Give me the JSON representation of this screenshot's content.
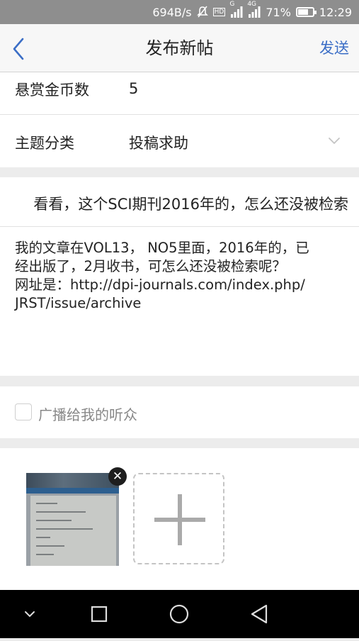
{
  "status_bar": {
    "net_speed": "694B/s",
    "hd_label": "HD",
    "signal_1_tag": "G",
    "signal_2_tag": "4G",
    "battery_percent": "71%",
    "battery_level": 0.71,
    "time": "12:29"
  },
  "nav": {
    "title": "发布新帖",
    "send_label": "发送"
  },
  "form": {
    "reward_label": "悬赏金币数",
    "reward_value": "5",
    "category_label": "主题分类",
    "category_value": "投稿求助",
    "title_text": "看看，这个SCI期刊2016年的，怎么还没被检索",
    "body_lines": [
      "我的文章在VOL13， NO5里面，2016年的，已",
      "经出版了，2月收书，可怎么还没被检索呢？",
      "网址是：http://dpi-journals.com/index.php/",
      "JRST/issue/archive"
    ],
    "broadcast_label": "广播给我的听众",
    "broadcast_checked": false
  },
  "icons": {
    "back": "chevron-left-icon",
    "dropdown": "chevron-down-icon",
    "remove": "close-icon",
    "add": "plus-icon"
  },
  "colors": {
    "accent": "#3b6ec6",
    "status_bar": "#8e8e8e",
    "nav_background": "#f7f7f7",
    "page_background": "#ececec"
  }
}
